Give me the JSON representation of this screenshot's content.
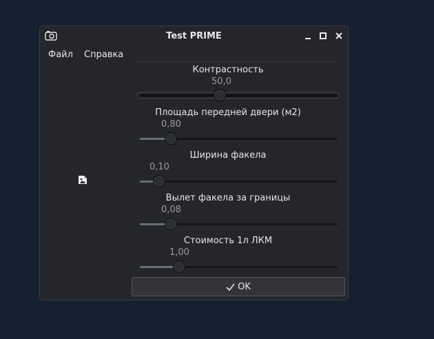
{
  "window": {
    "title": "Test PRIME"
  },
  "menu": {
    "file": "Файл",
    "help": "Справка"
  },
  "sliders": [
    {
      "label": "Контрастность",
      "value_text": "50,0",
      "fraction": 0.4
    },
    {
      "label": "Площадь передней двери (м2)",
      "value_text": "0,80",
      "fraction": 0.16
    },
    {
      "label": "Ширина факела",
      "value_text": "0,10",
      "fraction": 0.1
    },
    {
      "label": "Вылет факела за границы",
      "value_text": "0,08",
      "fraction": 0.16
    },
    {
      "label": "Стоимость 1л ЛКМ",
      "value_text": "1,00",
      "fraction": 0.2
    }
  ],
  "ok_button": {
    "label": "OK"
  },
  "colors": {
    "desktop": "#172031",
    "window": "#25262b",
    "text": "#e6e6e6"
  },
  "icons": [
    "camera-icon",
    "minimize-icon",
    "maximize-icon",
    "close-icon",
    "image-file-icon",
    "check-icon"
  ]
}
